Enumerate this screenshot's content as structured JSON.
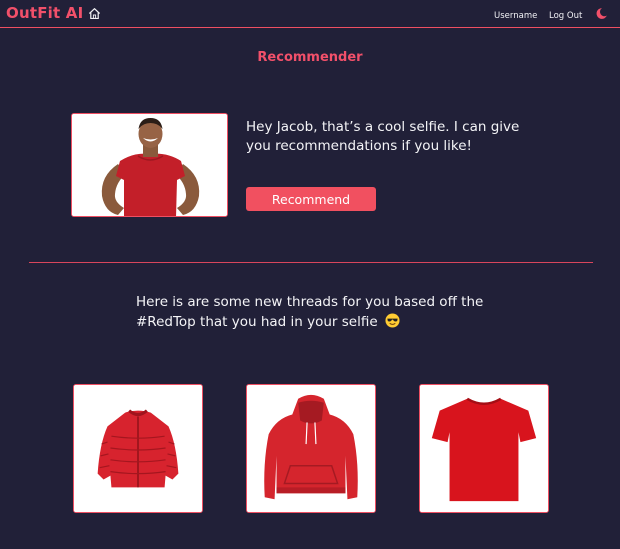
{
  "header": {
    "brand": "OutFit AI",
    "username_link": "Username",
    "logout_link": "Log Out",
    "icons": {
      "home": "home-icon",
      "theme": "moon-icon"
    }
  },
  "page": {
    "title": "Recommender"
  },
  "selfie": {
    "greeting": "Hey Jacob, that’s a cool selfie.  I can give you recommendations if you like!",
    "button_label": "Recommend"
  },
  "results": {
    "message": "Here is are some new threads for you based off the #RedTop that you had in your selfie",
    "emoji": "sunglasses-emoji-icon",
    "items": [
      {
        "type": "red-puffer-jacket"
      },
      {
        "type": "red-hoodie"
      },
      {
        "type": "red-t-shirt"
      }
    ]
  },
  "colors": {
    "background": "#212038",
    "accent": "#f2506a",
    "text": "#f3f3f6",
    "card": "#ffffff"
  }
}
